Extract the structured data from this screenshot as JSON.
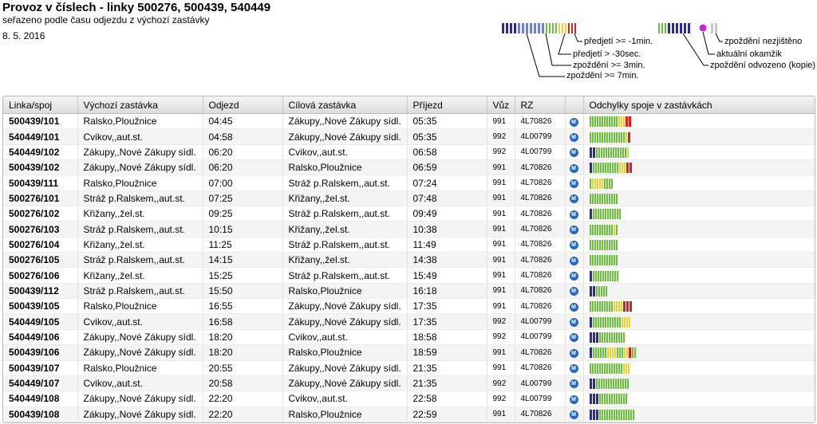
{
  "header": {
    "title": "Provoz v číslech - linky 500276, 500439, 540449",
    "subtitle": "seřazeno podle času odjezdu z výchozí zastávky",
    "date": "8. 5. 2016"
  },
  "legend": {
    "predjeti_1min": "předjetí >= -1min.",
    "predjeti_30sec": "předjetí > -30sec.",
    "zpozdeni_3min": "zpoždění >= 3min.",
    "zpozdeni_7min": "zpoždění >= 7min.",
    "nezjisteno": "zpoždění nezjištěno",
    "aktualni": "aktuální okamžik",
    "odvozeno": "zpoždění odvozeno (kopie)"
  },
  "colors": {
    "early_1min": "#2a2a9a",
    "early_30s": "#6c7fe0",
    "ontime": "#6cbf3a",
    "late_3min": "#e8d23a",
    "late_7min": "#d62020",
    "unknown": "#9a9a9a",
    "current": "#d020d0",
    "m_icon": "#2467c4"
  },
  "table": {
    "columns": [
      "Linka/spoj",
      "Výchozí zastávka",
      "Odjezd",
      "Cílová zastávka",
      "Příjezd",
      "Vůz",
      "RZ",
      "",
      "Odchylky spoje v zastávkách"
    ],
    "rows": [
      {
        "line": "500439/101",
        "from": "Ralsko,Ploužnice",
        "dep": "04:45",
        "to": "Zákupy,,Nové Zákupy sídl.",
        "arr": "05:35",
        "car": "991",
        "rz": "4L70826",
        "icon": "M",
        "bars": "ggggggggggggyyyrr"
      },
      {
        "line": "540449/101",
        "from": "Cvikov,,aut.st.",
        "dep": "04:58",
        "to": "Zákupy,,Nové Zákupy sídl.",
        "arr": "05:35",
        "car": "992",
        "rz": "4L00799",
        "icon": "M",
        "bars": "gggggggggggggggyr"
      },
      {
        "line": "540449/102",
        "from": "Zákupy,,Nové Zákupy sídl.",
        "dep": "06:20",
        "to": "Cvikov,,aut.st.",
        "arr": "06:58",
        "car": "992",
        "rz": "4L00799",
        "icon": "M",
        "bars": "bbgggggggggggggy"
      },
      {
        "line": "500439/102",
        "from": "Zákupy,,Nové Zákupy sídl.",
        "dep": "06:20",
        "to": "Ralsko,Ploužnice",
        "arr": "06:59",
        "car": "991",
        "rz": "4L70826",
        "icon": "M",
        "bars": "bgggggggggggyyyrr"
      },
      {
        "line": "500439/111",
        "from": "Ralsko,Ploužnice",
        "dep": "07:00",
        "to": "Stráž p.Ralskem,,aut.st.",
        "arr": "07:24",
        "car": "991",
        "rz": "4L70826",
        "icon": "M",
        "bars": "gyyyyygggg"
      },
      {
        "line": "500276/101",
        "from": "Stráž p.Ralskem,,aut.st.",
        "dep": "07:25",
        "to": "Křižany,,žel.st.",
        "arr": "07:48",
        "car": "991",
        "rz": "4L70826",
        "icon": "M",
        "bars": "gggggggggggg"
      },
      {
        "line": "500276/102",
        "from": "Křižany,,žel.st.",
        "dep": "09:25",
        "to": "Stráž p.Ralskem,,aut.st.",
        "arr": "09:49",
        "car": "991",
        "rz": "4L70826",
        "icon": "M",
        "bars": "bgggggggggggg"
      },
      {
        "line": "500276/103",
        "from": "Stráž p.Ralskem,,aut.st.",
        "dep": "10:15",
        "to": "Křižany,,žel.st.",
        "arr": "10:38",
        "car": "991",
        "rz": "4L70826",
        "icon": "M",
        "bars": "ggggggggggyg"
      },
      {
        "line": "500276/104",
        "from": "Křižany,,žel.st.",
        "dep": "11:25",
        "to": "Stráž p.Ralskem,,aut.st.",
        "arr": "11:49",
        "car": "991",
        "rz": "4L70826",
        "icon": "M",
        "bars": "gggggggggggg"
      },
      {
        "line": "500276/105",
        "from": "Stráž p.Ralskem,,aut.st.",
        "dep": "14:15",
        "to": "Křižany,,žel.st.",
        "arr": "14:38",
        "car": "991",
        "rz": "4L70826",
        "icon": "M",
        "bars": "gggggggggggg"
      },
      {
        "line": "500276/106",
        "from": "Křižany,,žel.st.",
        "dep": "15:25",
        "to": "Stráž p.Ralskem,,aut.st.",
        "arr": "15:49",
        "car": "991",
        "rz": "4L70826",
        "icon": "M",
        "bars": "bggggggggggg"
      },
      {
        "line": "500439/112",
        "from": "Stráž p.Ralskem,,aut.st.",
        "dep": "15:50",
        "to": "Ralsko,Ploužnice",
        "arr": "16:18",
        "car": "991",
        "rz": "4L70826",
        "icon": "M",
        "bars": "bbggggg"
      },
      {
        "line": "500439/105",
        "from": "Ralsko,Ploužnice",
        "dep": "16:55",
        "to": "Zákupy,,Nové Zákupy sídl.",
        "arr": "17:35",
        "car": "991",
        "rz": "4L70826",
        "icon": "M",
        "bars": "ggggggggggyyyyrrr"
      },
      {
        "line": "540449/105",
        "from": "Cvikov,,aut.st.",
        "dep": "16:58",
        "to": "Zákupy,,Nové Zákupy sídl.",
        "arr": "17:35",
        "car": "992",
        "rz": "4L00799",
        "icon": "M",
        "bars": "bggggggggggggyyyy"
      },
      {
        "line": "540449/106",
        "from": "Zákupy,,Nové Zákupy sídl.",
        "dep": "18:20",
        "to": "Cvikov,,aut.st.",
        "arr": "18:58",
        "car": "992",
        "rz": "4L00799",
        "icon": "M",
        "bars": "bbbggggggggggg"
      },
      {
        "line": "500439/106",
        "from": "Zákupy,,Nové Zákupy sídl.",
        "dep": "18:20",
        "to": "Ralsko,Ploužnice",
        "arr": "18:59",
        "car": "991",
        "rz": "4L70826",
        "icon": "M",
        "bars": "bggggggyyyygggyyrgg"
      },
      {
        "line": "500439/107",
        "from": "Ralsko,Ploužnice",
        "dep": "20:55",
        "to": "Zákupy,,Nové Zákupy sídl.",
        "arr": "21:35",
        "car": "991",
        "rz": "4L70826",
        "icon": "M",
        "bars": "ggggggggggggggyyy"
      },
      {
        "line": "540449/107",
        "from": "Cvikov,,aut.st.",
        "dep": "20:58",
        "to": "Zákupy,,Nové Zákupy sídl.",
        "arr": "21:35",
        "car": "992",
        "rz": "4L00799",
        "icon": "M",
        "bars": "bbgggggggggggggg"
      },
      {
        "line": "540449/108",
        "from": "Zákupy,,Nové Zákupy sídl.",
        "dep": "22:20",
        "to": "Cvikov,,aut.st.",
        "arr": "22:58",
        "car": "992",
        "rz": "4L00799",
        "icon": "M",
        "bars": "bbbgggggggggggg"
      },
      {
        "line": "500439/108",
        "from": "Zákupy,,Nové Zákupy sídl.",
        "dep": "22:20",
        "to": "Ralsko,Ploužnice",
        "arr": "22:59",
        "car": "991",
        "rz": "4L70826",
        "icon": "M",
        "bars": "bbbggggggggggggggg"
      }
    ]
  }
}
